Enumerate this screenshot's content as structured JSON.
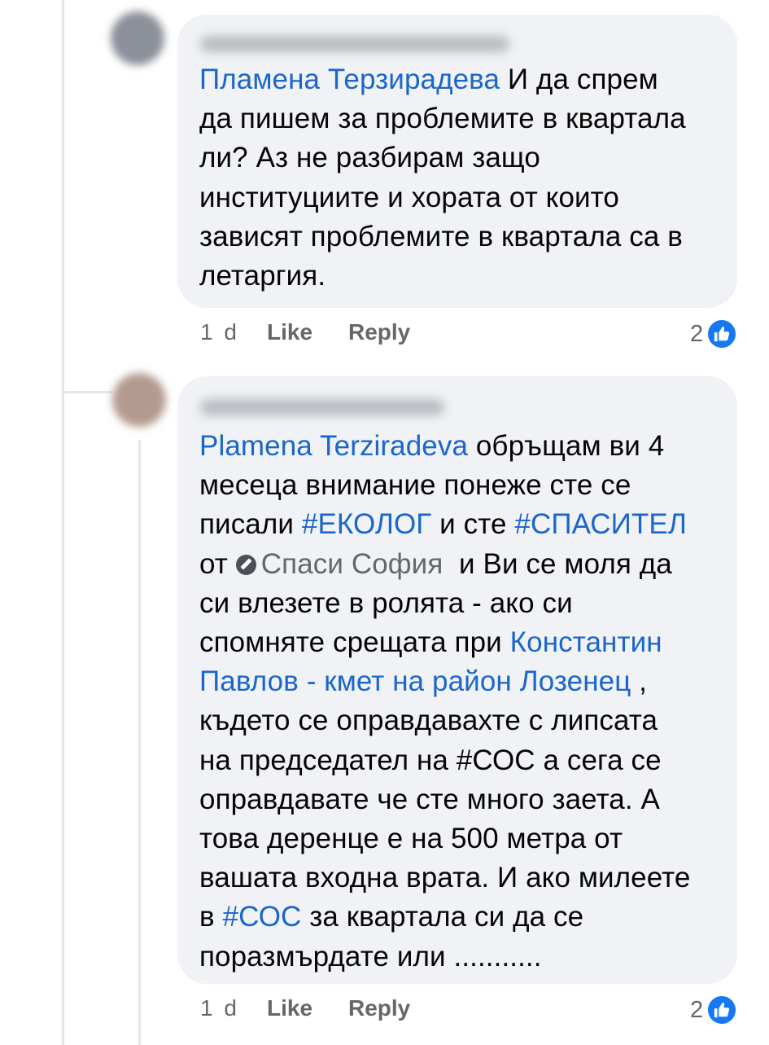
{
  "comments": [
    {
      "mention": "Пламена Терзирадева",
      "lines": [
        " И да спрем",
        "да пишем за проблемите в квартала",
        "ли? Аз не разбирам защо",
        "институциите и хората от които",
        "зависят проблемите в квартала са в",
        "летаргия."
      ],
      "time": "1 d",
      "like_label": "Like",
      "reply_label": "Reply",
      "reaction_count": "2"
    },
    {
      "mention": "Plamena Terziradeva",
      "text": {
        "l1_after_mention": " обръщам ви 4",
        "l2": "месеца внимание понеже сте се",
        "l3_before": "писали ",
        "hashtag_ekolog": "#ЕКОЛОГ",
        "l3_mid": " и сте ",
        "hashtag_spasitel": "#СПАСИТЕЛ",
        "l4_before": "от ",
        "page_mention": "Спаси София",
        "l4_after": "  и Ви се моля да",
        "l5": "си влезете в ролята - ако си",
        "l6_before": "спомняте срещата при ",
        "mention_mayor_a": "Константин",
        "mention_mayor_b": "Павлов - кмет на район Лозенец",
        "l7_after": " ,",
        "l8": "където се оправдавахте с липсата",
        "l9": "на председател на #СОС а сега се",
        "l10": "оправдавате че сте много заета. А",
        "l11": "това деренце е на 500 метра от",
        "l12": "вашата входна врата. И ако милеете",
        "l13_before": "в ",
        "hashtag_sos": "#СОС",
        "l13_after": " за квартала си да се",
        "l14": "поразмърдате или ..........."
      },
      "time": "1 d",
      "like_label": "Like",
      "reply_label": "Reply",
      "reaction_count": "2"
    }
  ],
  "colors": {
    "link": "#1b66c9",
    "bubble": "#f0f2f5",
    "meta": "#65676b",
    "like_blue": "#1877f2"
  },
  "icons": {
    "reaction": "like-thumbs-up-icon",
    "page": "page-badge-icon"
  }
}
